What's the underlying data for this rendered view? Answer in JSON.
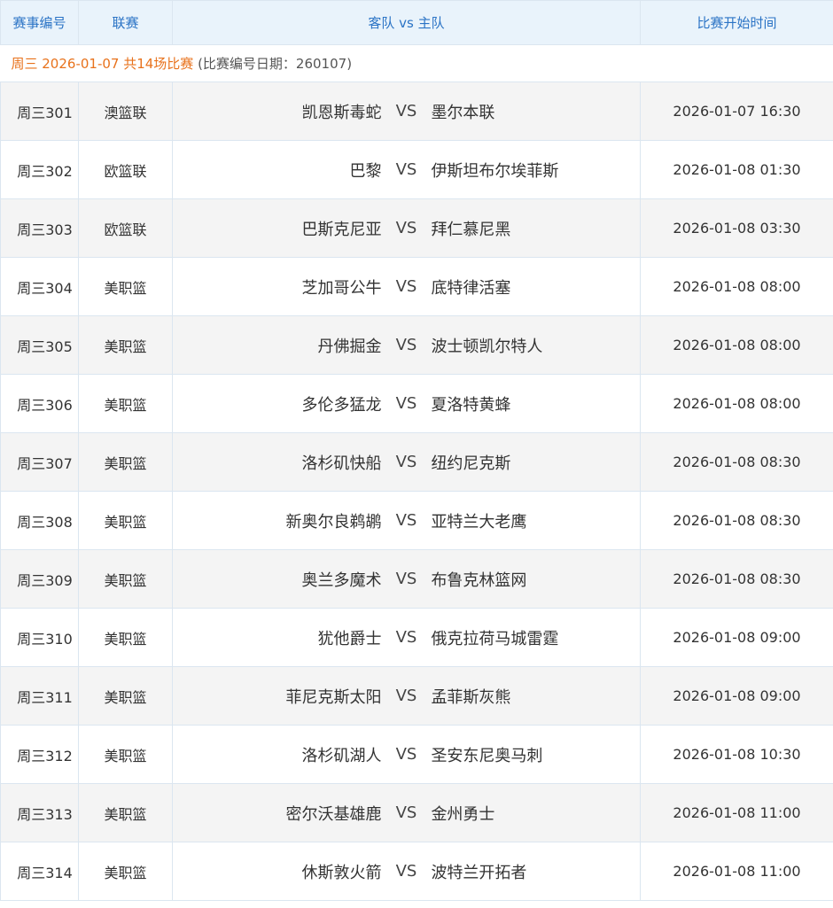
{
  "header": {
    "col_id": "赛事编号",
    "col_league": "联赛",
    "col_teams": "客队 vs 主队",
    "col_time": "比赛开始时间"
  },
  "date_group": {
    "highlight": "周三 2026-01-07 共14场比赛",
    "note": "(比赛编号日期：260107)"
  },
  "vs_label": "VS",
  "matches": [
    {
      "id": "周三301",
      "league": "澳篮联",
      "away": "凯恩斯毒蛇",
      "home": "墨尔本联",
      "time": "2026-01-07 16:30"
    },
    {
      "id": "周三302",
      "league": "欧篮联",
      "away": "巴黎",
      "home": "伊斯坦布尔埃菲斯",
      "time": "2026-01-08 01:30"
    },
    {
      "id": "周三303",
      "league": "欧篮联",
      "away": "巴斯克尼亚",
      "home": "拜仁慕尼黑",
      "time": "2026-01-08 03:30"
    },
    {
      "id": "周三304",
      "league": "美职篮",
      "away": "芝加哥公牛",
      "home": "底特律活塞",
      "time": "2026-01-08 08:00"
    },
    {
      "id": "周三305",
      "league": "美职篮",
      "away": "丹佛掘金",
      "home": "波士顿凯尔特人",
      "time": "2026-01-08 08:00"
    },
    {
      "id": "周三306",
      "league": "美职篮",
      "away": "多伦多猛龙",
      "home": "夏洛特黄蜂",
      "time": "2026-01-08 08:00"
    },
    {
      "id": "周三307",
      "league": "美职篮",
      "away": "洛杉矶快船",
      "home": "纽约尼克斯",
      "time": "2026-01-08 08:30"
    },
    {
      "id": "周三308",
      "league": "美职篮",
      "away": "新奥尔良鹈鹕",
      "home": "亚特兰大老鹰",
      "time": "2026-01-08 08:30"
    },
    {
      "id": "周三309",
      "league": "美职篮",
      "away": "奥兰多魔术",
      "home": "布鲁克林篮网",
      "time": "2026-01-08 08:30"
    },
    {
      "id": "周三310",
      "league": "美职篮",
      "away": "犹他爵士",
      "home": "俄克拉荷马城雷霆",
      "time": "2026-01-08 09:00"
    },
    {
      "id": "周三311",
      "league": "美职篮",
      "away": "菲尼克斯太阳",
      "home": "孟菲斯灰熊",
      "time": "2026-01-08 09:00"
    },
    {
      "id": "周三312",
      "league": "美职篮",
      "away": "洛杉矶湖人",
      "home": "圣安东尼奥马刺",
      "time": "2026-01-08 10:30"
    },
    {
      "id": "周三313",
      "league": "美职篮",
      "away": "密尔沃基雄鹿",
      "home": "金州勇士",
      "time": "2026-01-08 11:00"
    },
    {
      "id": "周三314",
      "league": "美职篮",
      "away": "休斯敦火箭",
      "home": "波特兰开拓者",
      "time": "2026-01-08 11:00"
    }
  ]
}
